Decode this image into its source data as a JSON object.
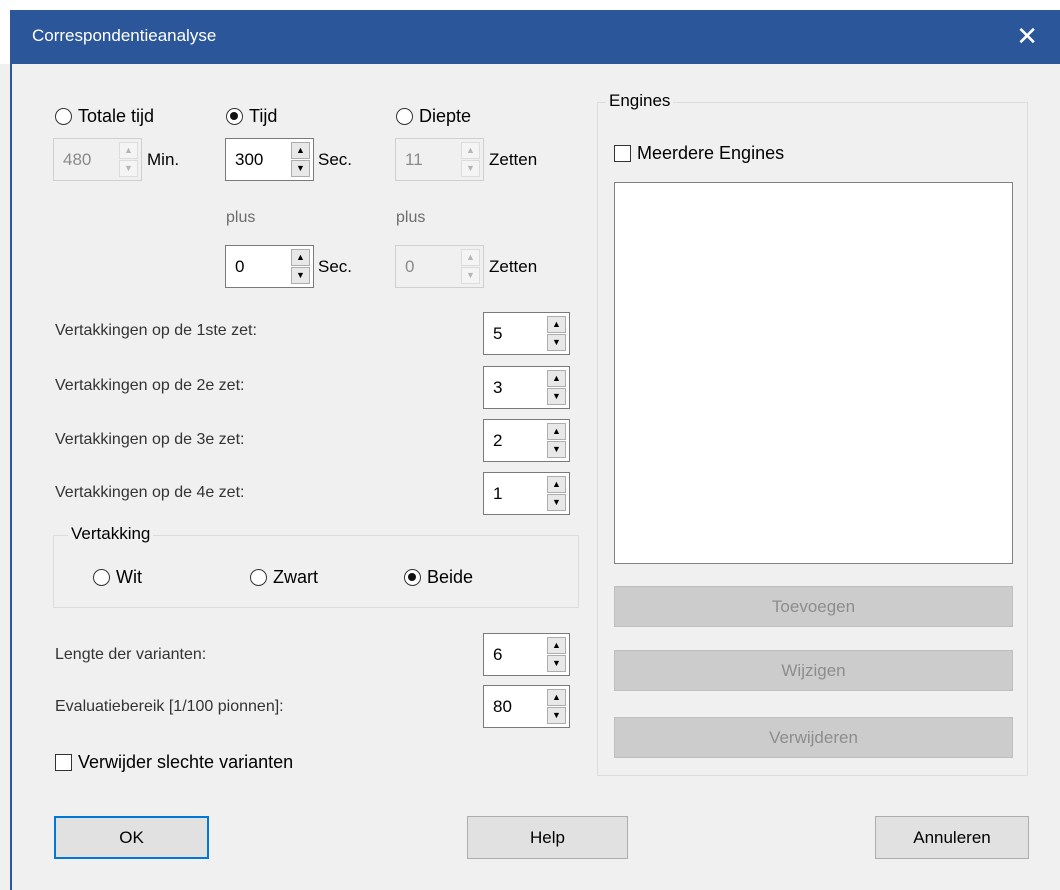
{
  "window": {
    "title": "Correspondentieanalyse",
    "close_glyph": "✕"
  },
  "time": {
    "total": {
      "label": "Totale tijd",
      "value": "480",
      "unit": "Min.",
      "selected": false
    },
    "tijd": {
      "label": "Tijd",
      "value": "300",
      "unit": "Sec.",
      "plus_label": "plus",
      "plus_value": "0",
      "plus_unit": "Sec.",
      "selected": true
    },
    "diepte": {
      "label": "Diepte",
      "value": "11",
      "unit": "Zetten",
      "plus_label": "plus",
      "plus_value": "0",
      "plus_unit": "Zetten",
      "selected": false
    }
  },
  "branches": [
    {
      "label": "Vertakkingen op de 1ste zet:",
      "value": "5"
    },
    {
      "label": "Vertakkingen op de 2e zet:",
      "value": "3"
    },
    {
      "label": "Vertakkingen op de 3e zet:",
      "value": "2"
    },
    {
      "label": "Vertakkingen op de 4e zet:",
      "value": "1"
    }
  ],
  "vertakking": {
    "title": "Vertakking",
    "options": [
      {
        "label": "Wit",
        "selected": false
      },
      {
        "label": "Zwart",
        "selected": false
      },
      {
        "label": "Beide",
        "selected": true
      }
    ]
  },
  "variant_length": {
    "label": "Lengte der varianten:",
    "value": "6"
  },
  "eval_range": {
    "label": "Evaluatiebereik [1/100 pionnen]:",
    "value": "80"
  },
  "remove_bad": {
    "label": "Verwijder slechte varianten",
    "checked": false
  },
  "engines": {
    "title": "Engines",
    "multi_label": "Meerdere Engines",
    "multi_checked": false,
    "add_label": "Toevoegen",
    "edit_label": "Wijzigen",
    "remove_label": "Verwijderen"
  },
  "footer": {
    "ok_label": "OK",
    "help_label": "Help",
    "cancel_label": "Annuleren"
  },
  "colors": {
    "titlebar": "#2b579a",
    "focus": "#0078d7"
  }
}
